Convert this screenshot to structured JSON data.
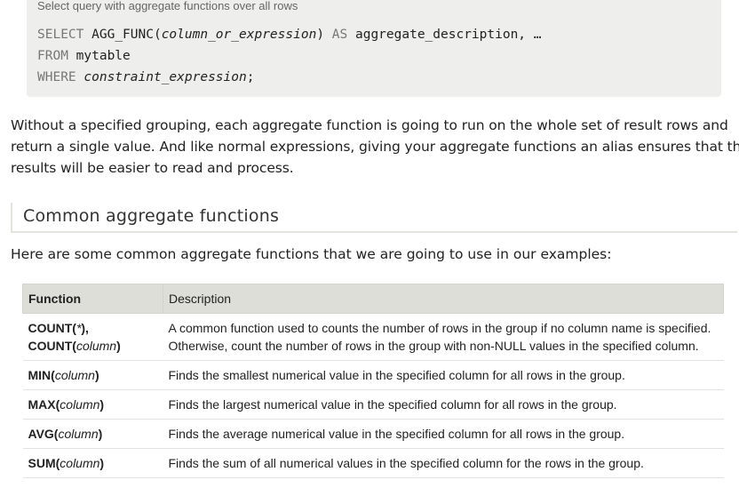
{
  "query_box": {
    "caption": "Select query with aggregate functions over all rows",
    "line1": {
      "select_kw": "SELECT",
      "func": "AGG_FUNC(",
      "arg": "column_or_expression",
      "close": ")",
      "as_kw": "AS",
      "rest": "aggregate_description, …"
    },
    "line2": {
      "from_kw": "FROM",
      "table": "mytable"
    },
    "line3": {
      "where_kw": "WHERE",
      "expr": "constraint_expression",
      "end": ";"
    }
  },
  "paragraph": [
    "Without a specified grouping, each aggregate function is going to run on the whole set of result rows and",
    "return a single value. And like normal expressions, giving your aggregate functions an alias ensures that the",
    "results will be easier to read and process."
  ],
  "section_title": "Common aggregate functions",
  "intro_text": "Here are some common aggregate functions that we are going to use in our examples:",
  "table": {
    "headers": {
      "function": "Function",
      "description": "Description"
    },
    "rows": [
      {
        "fn1": "COUNT(",
        "arg1": "*",
        "close1": "),",
        "fn2": "COUNT(",
        "arg2": "column",
        "close2": ")",
        "desc": "A common function used to counts the number of rows in the group if no column name is specified. Otherwise, count the number of rows in the group with non-NULL values in the specified column."
      },
      {
        "fn": "MIN(",
        "arg": "column",
        "close": ")",
        "desc": "Finds the smallest numerical value in the specified column for all rows in the group."
      },
      {
        "fn": "MAX(",
        "arg": "column",
        "close": ")",
        "desc": "Finds the largest numerical value in the specified column for all rows in the group."
      },
      {
        "fn": "AVG(",
        "arg": "column",
        "close": ")",
        "desc": "Finds the average numerical value in the specified column for all rows in the group."
      },
      {
        "fn": "SUM(",
        "arg": "column",
        "close": ")",
        "desc": "Finds the sum of all numerical values in the specified column for the rows in the group."
      }
    ]
  }
}
